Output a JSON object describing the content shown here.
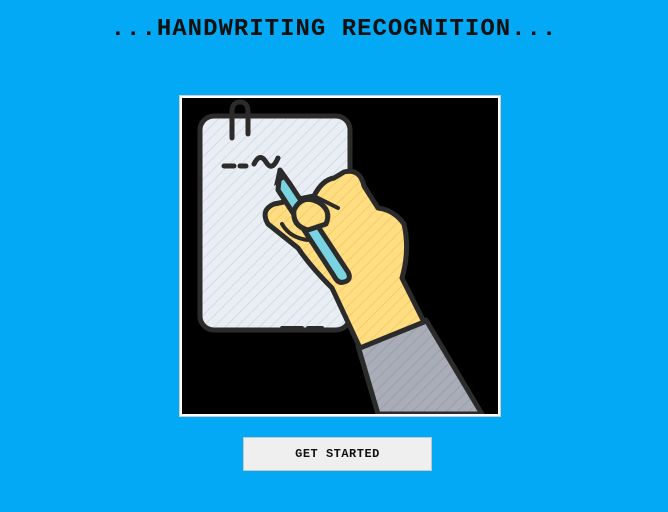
{
  "header": {
    "title": "...HANDWRITING RECOGNITION..."
  },
  "hero": {
    "image_icon": "hand-writing-on-paper-illustration"
  },
  "actions": {
    "get_started_label": "GET STARTED"
  },
  "colors": {
    "background": "#03a9f4",
    "image_background": "#000000",
    "paper": "#e8eef3",
    "hand": "#ffdd80",
    "pencil": "#7ad3e0",
    "sleeve": "#a9adb8",
    "outline": "#2b2b2b"
  }
}
